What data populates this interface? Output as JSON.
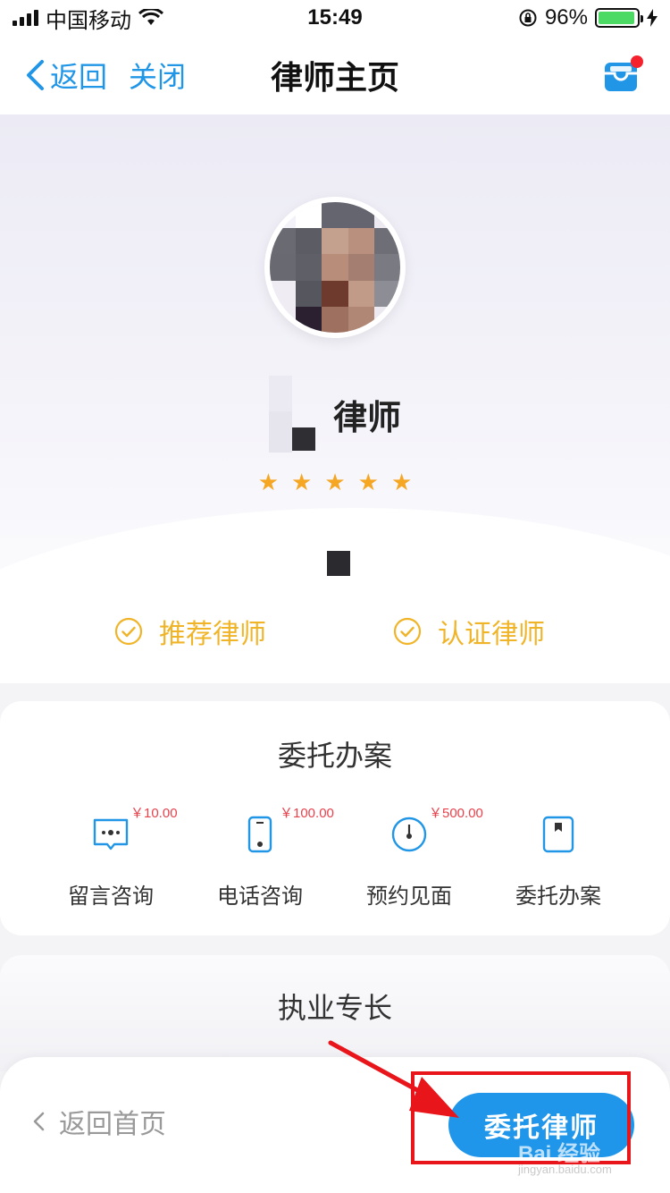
{
  "status": {
    "carrier": "中国移动",
    "time": "15:49",
    "battery": "96%",
    "battery_level": 0.96
  },
  "nav": {
    "back_label": "返回",
    "close_label": "关闭",
    "title": "律师主页"
  },
  "profile": {
    "name_suffix": "律师",
    "rating_stars": "★★★★★",
    "rating": 5,
    "badges": [
      "推荐律师",
      "认证律师"
    ]
  },
  "services": {
    "title": "委托办案",
    "items": [
      {
        "label": "留言咨询",
        "price": "￥10.00",
        "icon": "message-icon"
      },
      {
        "label": "电话咨询",
        "price": "￥100.00",
        "icon": "phone-icon"
      },
      {
        "label": "预约见面",
        "price": "￥500.00",
        "icon": "clock-icon"
      },
      {
        "label": "委托办案",
        "price": "",
        "icon": "bookmark-icon"
      }
    ]
  },
  "expertise": {
    "title": "执业专长"
  },
  "bottom": {
    "home_label": "返回首页",
    "cta_label": "委托律师"
  },
  "watermark": {
    "text": "Bai 经验",
    "sub": "jingyan.baidu.com"
  },
  "colors": {
    "accent": "#1f96ea",
    "badge": "#f0b429",
    "price": "#e8424c",
    "annotation": "#e8151b"
  }
}
